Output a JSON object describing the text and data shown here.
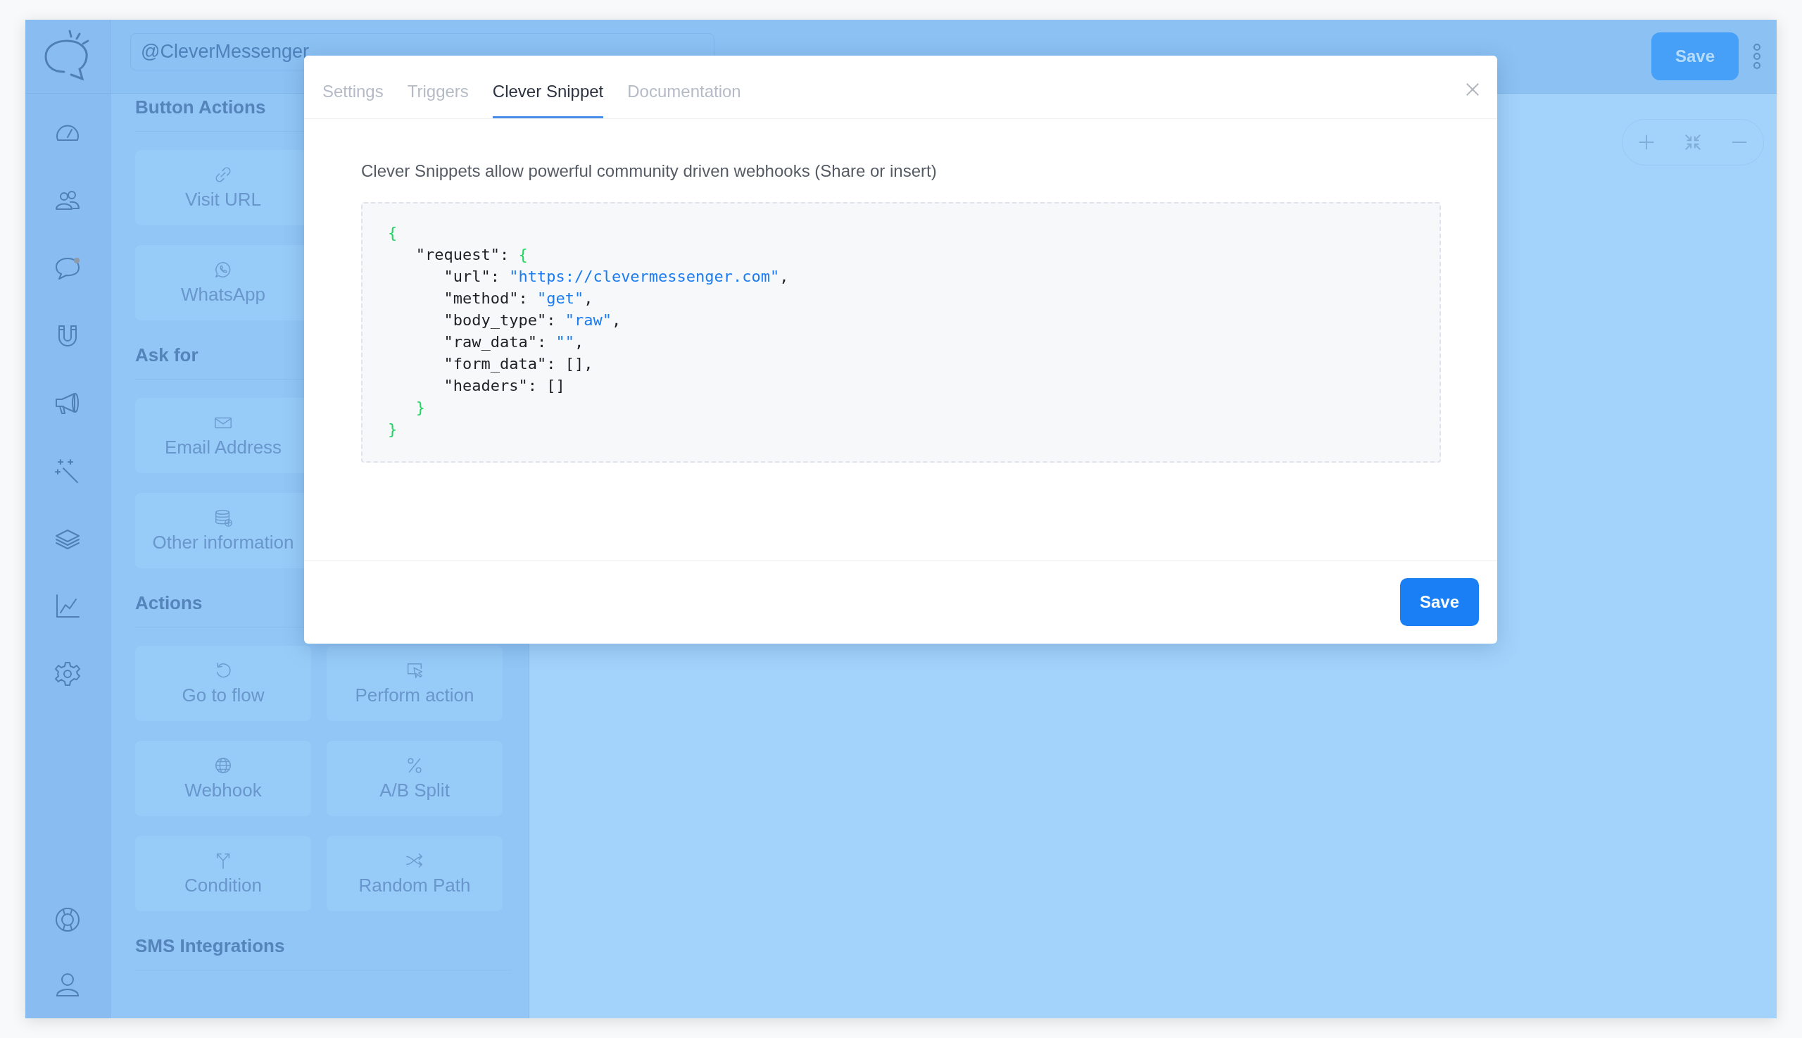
{
  "sidebar": {
    "top": [
      {
        "kind": "logo"
      }
    ],
    "items": [
      {
        "kind": "gauge"
      },
      {
        "kind": "users"
      },
      {
        "kind": "chat"
      },
      {
        "kind": "magnet"
      },
      {
        "kind": "megaphone"
      },
      {
        "kind": "wand"
      },
      {
        "kind": "layers"
      },
      {
        "kind": "chart"
      },
      {
        "kind": "gear"
      }
    ],
    "bottom": [
      {
        "kind": "lifebuoy"
      },
      {
        "kind": "user"
      }
    ]
  },
  "header": {
    "breadcrumb": [
      "@CleverMessenger"
    ],
    "save_button": "Save"
  },
  "palette": {
    "sections": [
      {
        "title": "Button Actions",
        "items": [
          {
            "label": "Visit URL",
            "kind": "link"
          },
          {
            "label": "WhatsApp",
            "kind": "whatsapp"
          }
        ]
      },
      {
        "title": "Ask for",
        "items": [
          {
            "label": "Email Address",
            "kind": "mail"
          },
          {
            "label": "Other information",
            "kind": "database"
          }
        ]
      },
      {
        "title": "Actions",
        "items": [
          {
            "label": "Go to flow",
            "kind": "refresh"
          },
          {
            "label": "Perform action",
            "kind": "cursor"
          },
          {
            "label": "Webhook",
            "kind": "globe"
          },
          {
            "label": "A/B Split",
            "kind": "percent"
          },
          {
            "label": "Condition",
            "kind": "fork"
          },
          {
            "label": "Random Path",
            "kind": "shuffle"
          }
        ]
      },
      {
        "title": "SMS Integrations"
      }
    ]
  },
  "modal": {
    "tabs": [
      {
        "label": "Settings",
        "selected": false
      },
      {
        "label": "Triggers",
        "selected": false
      },
      {
        "label": "Clever Snippet",
        "selected": true
      },
      {
        "label": "Documentation",
        "selected": false
      }
    ],
    "description": "Clever Snippets allow powerful community driven webhooks (Share or insert)",
    "code": [
      [
        {
          "kind": "brace",
          "text": "{"
        }
      ],
      [
        {
          "kind": "plain",
          "text": "   \"request\": "
        },
        {
          "kind": "brace",
          "text": "{"
        }
      ],
      [
        {
          "kind": "plain",
          "text": "      \"url\": "
        },
        {
          "kind": "string",
          "text": "\"https://clevermessenger.com\""
        },
        {
          "kind": "plain",
          "text": ","
        }
      ],
      [
        {
          "kind": "plain",
          "text": "      \"method\": "
        },
        {
          "kind": "string",
          "text": "\"get\""
        },
        {
          "kind": "plain",
          "text": ","
        }
      ],
      [
        {
          "kind": "plain",
          "text": "      \"body_type\": "
        },
        {
          "kind": "string",
          "text": "\"raw\""
        },
        {
          "kind": "plain",
          "text": ","
        }
      ],
      [
        {
          "kind": "plain",
          "text": "      \"raw_data\": "
        },
        {
          "kind": "string",
          "text": "\"\""
        },
        {
          "kind": "plain",
          "text": ","
        }
      ],
      [
        {
          "kind": "plain",
          "text": "      \"form_data\": [],"
        }
      ],
      [
        {
          "kind": "plain",
          "text": "      \"headers\": []"
        }
      ],
      [
        {
          "kind": "brace",
          "text": "   }"
        }
      ],
      [
        {
          "kind": "brace",
          "text": "}"
        }
      ]
    ],
    "save_button": "Save"
  }
}
